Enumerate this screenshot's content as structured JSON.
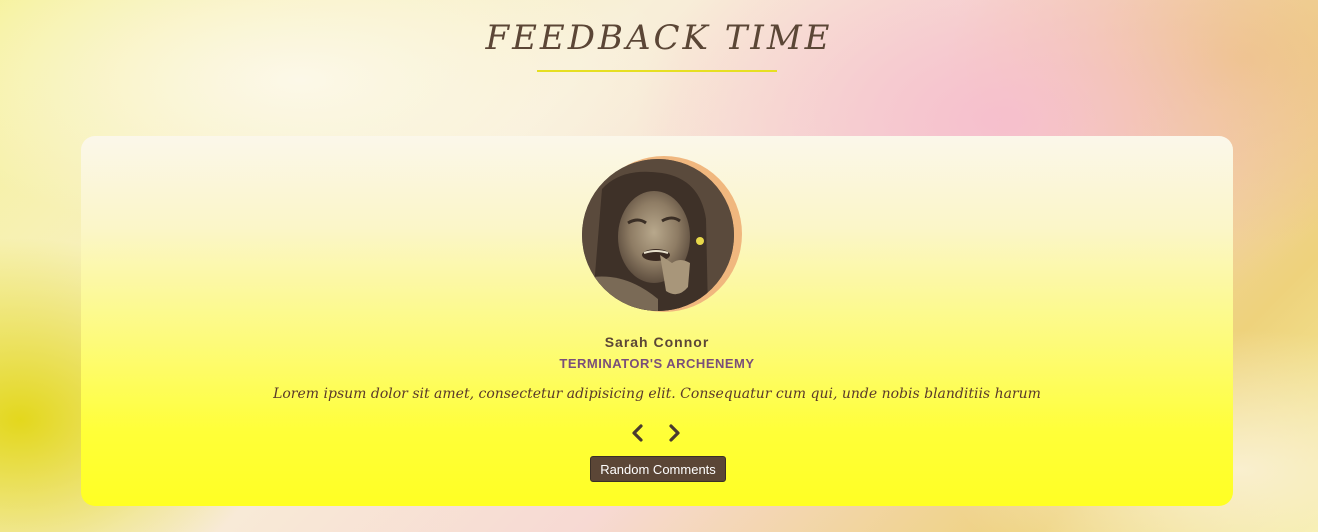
{
  "header": {
    "title": "FEEDBACK TIME"
  },
  "testimonial": {
    "name": "Sarah Connor",
    "role": "TERMINATOR'S ARCHENEMY",
    "comment": "Lorem ipsum dolor sit amet, consectetur adipisicing elit. Consequatur cum qui, unde nobis blanditiis harum"
  },
  "controls": {
    "prev_icon": "chevron-left-icon",
    "next_icon": "chevron-right-icon",
    "random_label": "Random Comments"
  },
  "colors": {
    "title": "#5b4636",
    "underline": "#e6df22",
    "name": "#5b4636",
    "role": "#7a4f7a",
    "button_bg": "#5b4636",
    "avatar_ring": "#f0b77e"
  }
}
